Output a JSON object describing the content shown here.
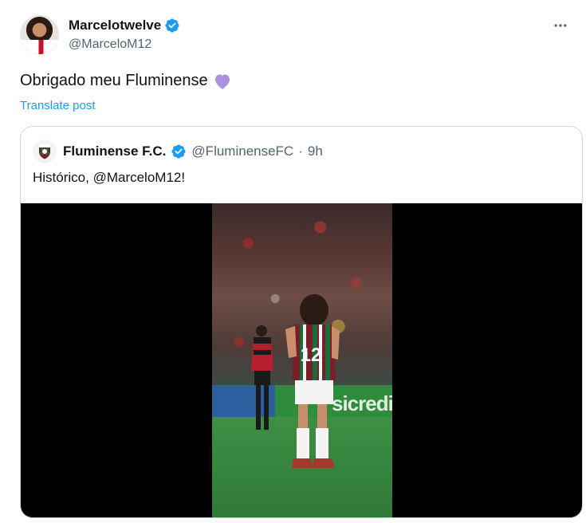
{
  "author": {
    "display_name": "Marcelotwelve",
    "handle": "@MarceloM12",
    "verified": true
  },
  "tweet": {
    "text": "Obrigado meu Fluminense",
    "emoji": "purple-heart",
    "translate_label": "Translate post"
  },
  "quoted": {
    "display_name": "Fluminense F.C.",
    "handle": "@FluminenseFC",
    "separator": "·",
    "time": "9h",
    "verified": true,
    "text": "Histórico, @MarceloM12!",
    "media": {
      "type": "video",
      "ad_text": "sicredi",
      "jersey_number": "12"
    }
  },
  "colors": {
    "accent": "#1d9bf0",
    "text": "#0f1419",
    "muted": "#536471",
    "border": "#cfd9de",
    "heart": "#ab91e0"
  },
  "icons": {
    "verified": "verified-badge-icon",
    "more": "more-options-icon"
  }
}
